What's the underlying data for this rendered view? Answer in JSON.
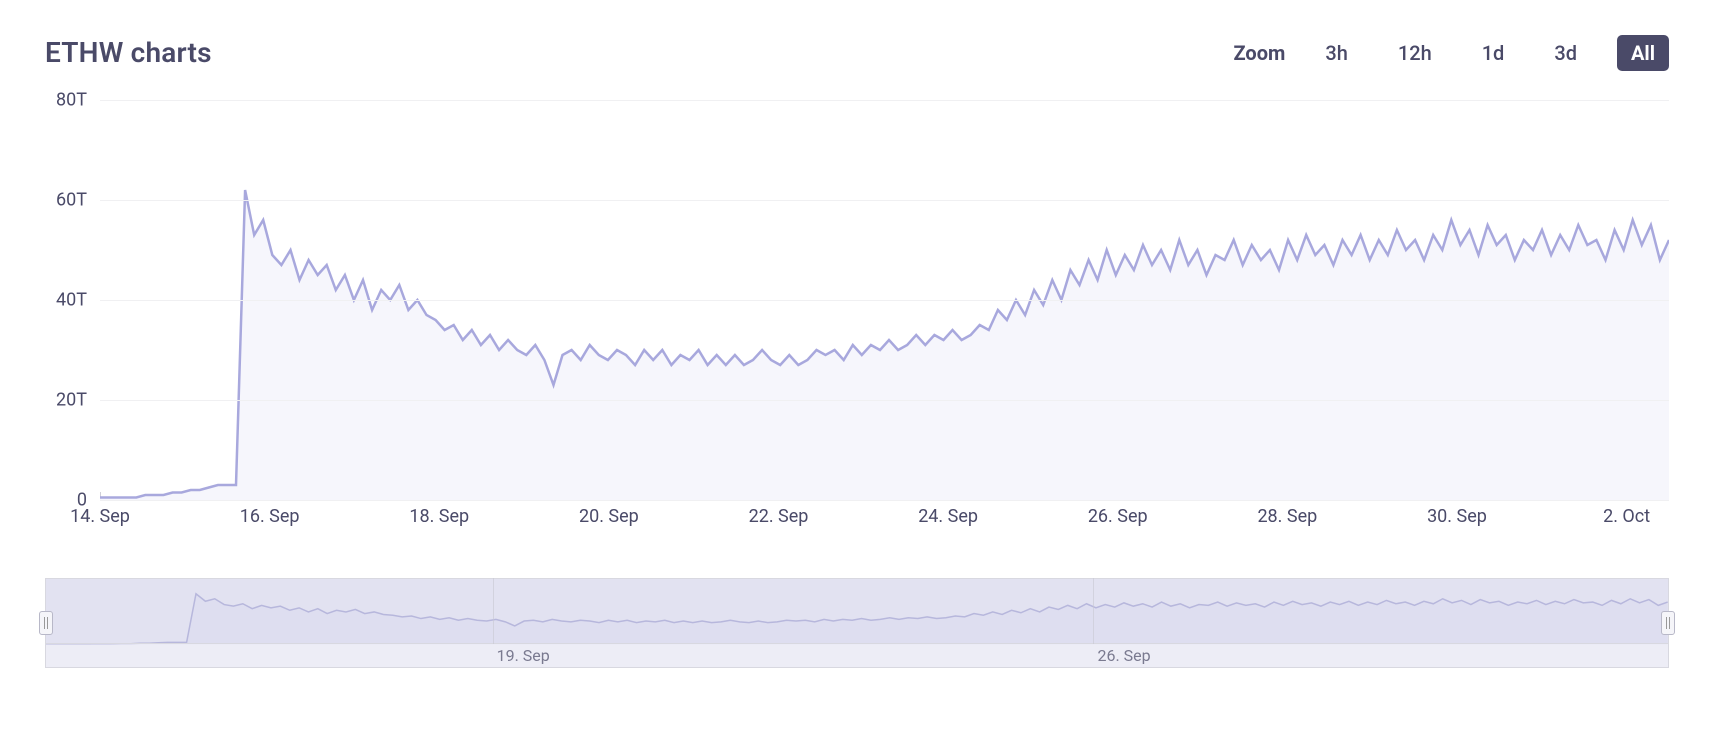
{
  "title": "ETHW charts",
  "zoom": {
    "label": "Zoom",
    "options": [
      "3h",
      "12h",
      "1d",
      "3d",
      "All"
    ],
    "active": "All"
  },
  "chart_data": {
    "type": "area",
    "title": "ETHW charts",
    "xlabel": "",
    "ylabel": "",
    "ylim": [
      0,
      80
    ],
    "y_unit": "T",
    "y_ticks": [
      0,
      20,
      40,
      60,
      80
    ],
    "x_ticks": [
      "14. Sep",
      "16. Sep",
      "18. Sep",
      "20. Sep",
      "22. Sep",
      "24. Sep",
      "26. Sep",
      "28. Sep",
      "30. Sep",
      "2. Oct"
    ],
    "x": [
      "14. Sep",
      "14.2",
      "14.4",
      "14.6",
      "14.8",
      "15. Sep",
      "15.2",
      "15.4",
      "15.6",
      "15.8",
      "16. Sep",
      "16.2",
      "16.4",
      "16.6",
      "16.8",
      "17. Sep",
      "17.05",
      "17.1",
      "17.15",
      "17.2",
      "17.3",
      "17.4",
      "17.5",
      "17.6",
      "17.7",
      "17.8",
      "17.9",
      "18. Sep",
      "18.1",
      "18.2",
      "18.3",
      "18.4",
      "18.5",
      "18.6",
      "18.7",
      "18.8",
      "18.9",
      "19. Sep",
      "19.1",
      "19.2",
      "19.3",
      "19.4",
      "19.5",
      "19.6",
      "19.7",
      "19.8",
      "19.9",
      "20. Sep",
      "20.1",
      "20.2",
      "20.25",
      "20.3",
      "20.4",
      "20.5",
      "20.6",
      "20.7",
      "20.8",
      "20.9",
      "21. Sep",
      "21.1",
      "21.2",
      "21.3",
      "21.4",
      "21.5",
      "21.6",
      "21.7",
      "21.8",
      "21.9",
      "22. Sep",
      "22.1",
      "22.2",
      "22.3",
      "22.4",
      "22.5",
      "22.6",
      "22.7",
      "22.8",
      "22.9",
      "23. Sep",
      "23.1",
      "23.2",
      "23.3",
      "23.4",
      "23.5",
      "23.6",
      "23.7",
      "23.8",
      "23.9",
      "24. Sep",
      "24.1",
      "24.2",
      "24.3",
      "24.4",
      "24.5",
      "24.6",
      "24.7",
      "24.8",
      "24.9",
      "25. Sep",
      "25.1",
      "25.2",
      "25.3",
      "25.4",
      "25.5",
      "25.6",
      "25.7",
      "25.8",
      "25.9",
      "26. Sep",
      "26.1",
      "26.2",
      "26.3",
      "26.4",
      "26.5",
      "26.6",
      "26.7",
      "26.8",
      "26.9",
      "27. Sep",
      "27.1",
      "27.2",
      "27.3",
      "27.4",
      "27.5",
      "27.6",
      "27.7",
      "27.8",
      "27.9",
      "28. Sep",
      "28.1",
      "28.2",
      "28.3",
      "28.4",
      "28.5",
      "28.6",
      "28.7",
      "28.8",
      "28.9",
      "29. Sep",
      "29.1",
      "29.2",
      "29.3",
      "29.4",
      "29.5",
      "29.6",
      "29.7",
      "29.8",
      "29.9",
      "30. Sep",
      "30.1",
      "30.2",
      "30.3",
      "30.4",
      "30.5",
      "30.6",
      "30.7",
      "30.8",
      "30.9",
      "1. Oct",
      "1.1",
      "1.2",
      "1.3",
      "1.4",
      "1.5",
      "1.6",
      "1.7",
      "1.8",
      "1.9",
      "2. Oct",
      "2.1",
      "2.2",
      "2.3",
      "2.4",
      "2.5"
    ],
    "values": [
      0.5,
      0.5,
      0.5,
      0.5,
      0.5,
      1,
      1,
      1,
      1.5,
      1.5,
      2,
      2,
      2.5,
      3,
      3,
      3,
      62,
      53,
      56,
      49,
      47,
      50,
      44,
      48,
      45,
      47,
      42,
      45,
      40,
      44,
      38,
      42,
      40,
      43,
      38,
      40,
      37,
      36,
      34,
      35,
      32,
      34,
      31,
      33,
      30,
      32,
      30,
      29,
      31,
      28,
      23,
      29,
      30,
      28,
      31,
      29,
      28,
      30,
      29,
      27,
      30,
      28,
      30,
      27,
      29,
      28,
      30,
      27,
      29,
      27,
      29,
      27,
      28,
      30,
      28,
      27,
      29,
      27,
      28,
      30,
      29,
      30,
      28,
      31,
      29,
      31,
      30,
      32,
      30,
      31,
      33,
      31,
      33,
      32,
      34,
      32,
      33,
      35,
      34,
      38,
      36,
      40,
      37,
      42,
      39,
      44,
      40,
      46,
      43,
      48,
      44,
      50,
      45,
      49,
      46,
      51,
      47,
      50,
      46,
      52,
      47,
      50,
      45,
      49,
      48,
      52,
      47,
      51,
      48,
      50,
      46,
      52,
      48,
      53,
      49,
      51,
      47,
      52,
      49,
      53,
      48,
      52,
      49,
      54,
      50,
      52,
      48,
      53,
      50,
      56,
      51,
      54,
      49,
      55,
      51,
      53,
      48,
      52,
      50,
      54,
      49,
      53,
      50,
      55,
      51,
      52,
      48,
      54,
      50,
      56,
      51,
      55,
      48,
      52
    ],
    "color": "#a8a8dd",
    "fill": "#f6f6fc"
  },
  "navigator": {
    "x_ticks": [
      "19. Sep",
      "26. Sep"
    ],
    "x_positions_pct": [
      27.5,
      64.5
    ]
  }
}
